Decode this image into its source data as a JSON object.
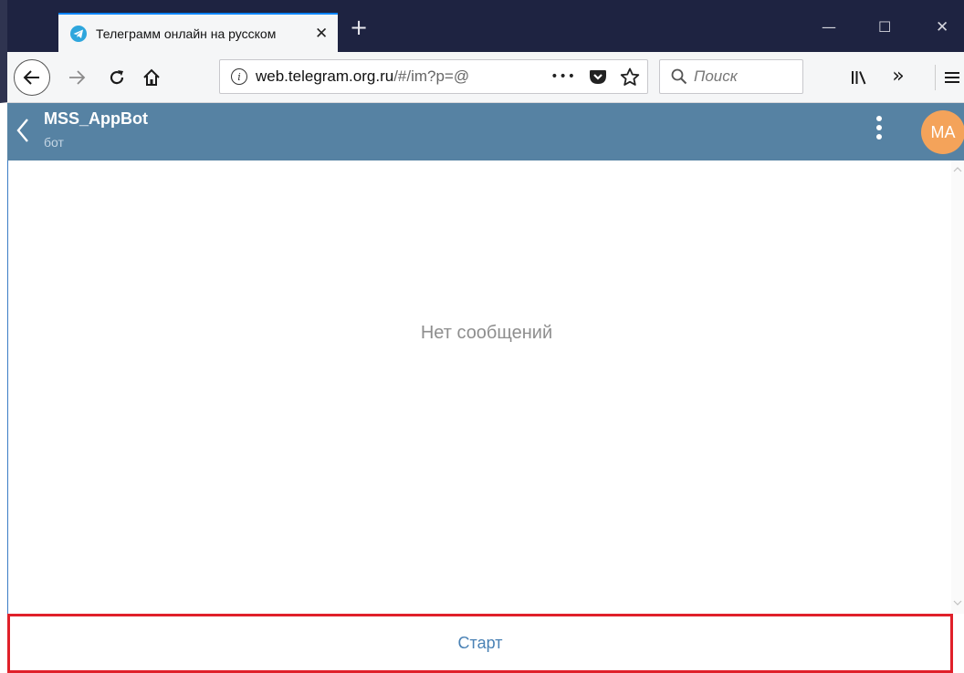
{
  "browser": {
    "tab": {
      "title": "Телеграмм онлайн на русском",
      "close_glyph": "✕"
    },
    "new_tab_glyph": "+",
    "window_controls": {
      "minimize": "—",
      "maximize": "☐",
      "close": "✕"
    },
    "url": {
      "host": "web.telegram.org.ru",
      "path": "/#/im?p=@"
    },
    "url_actions": {
      "more": "•••"
    },
    "search": {
      "placeholder": "Поиск"
    },
    "toolbar": {
      "overflow": "»"
    },
    "icons": [
      "back-arrow-icon",
      "forward-arrow-icon",
      "reload-icon",
      "home-icon",
      "info-icon",
      "pocket-icon",
      "bookmark-star-icon",
      "search-icon",
      "library-icon",
      "overflow-icon",
      "hamburger-menu-icon"
    ]
  },
  "chat": {
    "title": "MSS_AppBot",
    "subtitle": "бот",
    "avatar_initials": "MA",
    "empty_text": "Нет сообщений",
    "start_label": "Старт"
  },
  "colors": {
    "header_bg": "#5682a3",
    "avatar_bg": "#f4a35a",
    "start_text": "#4a82b5",
    "highlight_border": "#e0202a",
    "titlebar_bg": "#1e2341"
  }
}
